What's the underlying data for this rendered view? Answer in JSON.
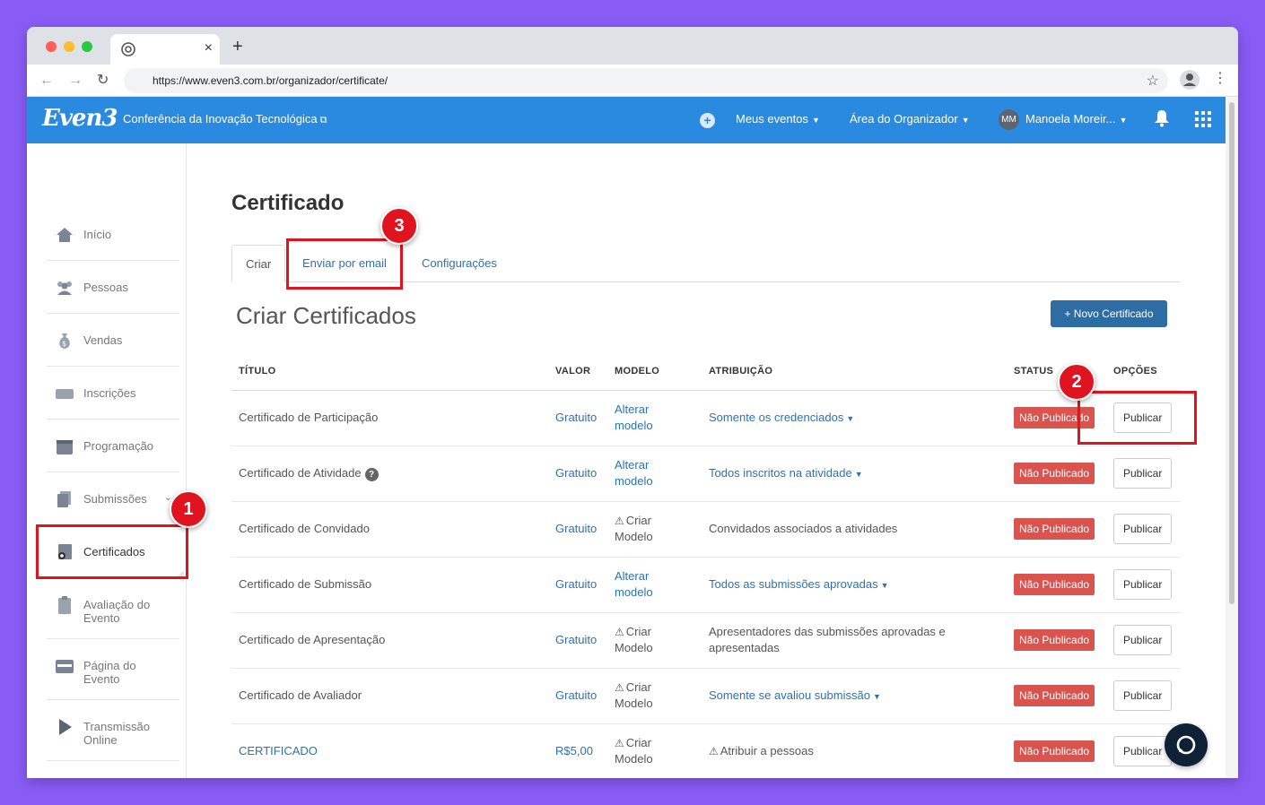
{
  "browser": {
    "url": "https://www.even3.com.br/organizador/certificate/",
    "tab_close": "×",
    "new_tab": "+"
  },
  "header": {
    "logo": "Even3",
    "event_name": "Conferência da Inovação Tecnológica",
    "my_events": "Meus eventos",
    "organizer_area": "Área do Organizador",
    "user_initials": "MM",
    "user_name": "Manoela Moreir..."
  },
  "sidebar": {
    "items": [
      {
        "label": "Início",
        "icon": "home-icon"
      },
      {
        "label": "Pessoas",
        "icon": "people-icon"
      },
      {
        "label": "Vendas",
        "icon": "money-bag-icon"
      },
      {
        "label": "Inscrições",
        "icon": "ticket-icon"
      },
      {
        "label": "Programação",
        "icon": "calendar-icon"
      },
      {
        "label": "Submissões",
        "icon": "documents-icon"
      },
      {
        "label": "Certificados",
        "icon": "certificate-icon"
      },
      {
        "label": "Avaliação do Evento",
        "icon": "clipboard-icon"
      },
      {
        "label": "Página do Evento",
        "icon": "browser-page-icon"
      },
      {
        "label": "Transmissão Online",
        "icon": "play-icon"
      }
    ]
  },
  "page": {
    "title": "Certificado",
    "tabs": [
      "Criar",
      "Enviar por email",
      "Configurações"
    ],
    "section_title": "Criar Certificados",
    "new_button": "+ Novo Certificado"
  },
  "table": {
    "headers": [
      "TÍTULO",
      "VALOR",
      "MODELO",
      "ATRIBUIÇÃO",
      "STATUS",
      "OPÇÕES"
    ],
    "rows": [
      {
        "title": "Certificado de Participação",
        "value": "Gratuito",
        "model": "Alterar modelo",
        "model_warn": false,
        "attribution": "Somente os credenciados",
        "attribution_link": true,
        "status": "Não Publicado",
        "action": "Publicar"
      },
      {
        "title": "Certificado de Atividade",
        "value": "Gratuito",
        "model": "Alterar modelo",
        "model_warn": false,
        "attribution": "Todos inscritos na atividade",
        "attribution_link": true,
        "status": "Não Publicado",
        "action": "Publicar"
      },
      {
        "title": "Certificado de Convidado",
        "value": "Gratuito",
        "model": "Criar Modelo",
        "model_warn": true,
        "attribution": "Convidados associados a atividades",
        "attribution_link": false,
        "status": "Não Publicado",
        "action": "Publicar"
      },
      {
        "title": "Certificado de Submissão",
        "value": "Gratuito",
        "model": "Alterar modelo",
        "model_warn": false,
        "attribution": "Todos as submissões aprovadas",
        "attribution_link": true,
        "status": "Não Publicado",
        "action": "Publicar"
      },
      {
        "title": "Certificado de Apresentação",
        "value": "Gratuito",
        "model": "Criar Modelo",
        "model_warn": true,
        "attribution": "Apresentadores das submissões aprovadas e apresentadas",
        "attribution_link": false,
        "status": "Não Publicado",
        "action": "Publicar"
      },
      {
        "title": "Certificado de Avaliador",
        "value": "Gratuito",
        "model": "Criar Modelo",
        "model_warn": true,
        "attribution": "Somente se avaliou submissão",
        "attribution_link": true,
        "status": "Não Publicado",
        "action": "Publicar"
      },
      {
        "title": "CERTIFICADO",
        "value": "R$5,00",
        "model": "Criar Modelo",
        "model_warn": true,
        "attribution": "Atribuir a pessoas",
        "attribution_link": false,
        "attribution_warn": true,
        "status": "Não Publicado",
        "action": "Publicar"
      }
    ]
  },
  "annotations": [
    {
      "number": "1",
      "target": "Certificados"
    },
    {
      "number": "2",
      "target": "Publicar"
    },
    {
      "number": "3",
      "target": "Enviar por email"
    }
  ],
  "colors": {
    "background": "#8a5cf6",
    "brand": "#2a8ae0",
    "primary_button": "#2e6da4",
    "badge": "#d9534f",
    "annotation": "#e0141e",
    "link": "#2a72b5"
  }
}
